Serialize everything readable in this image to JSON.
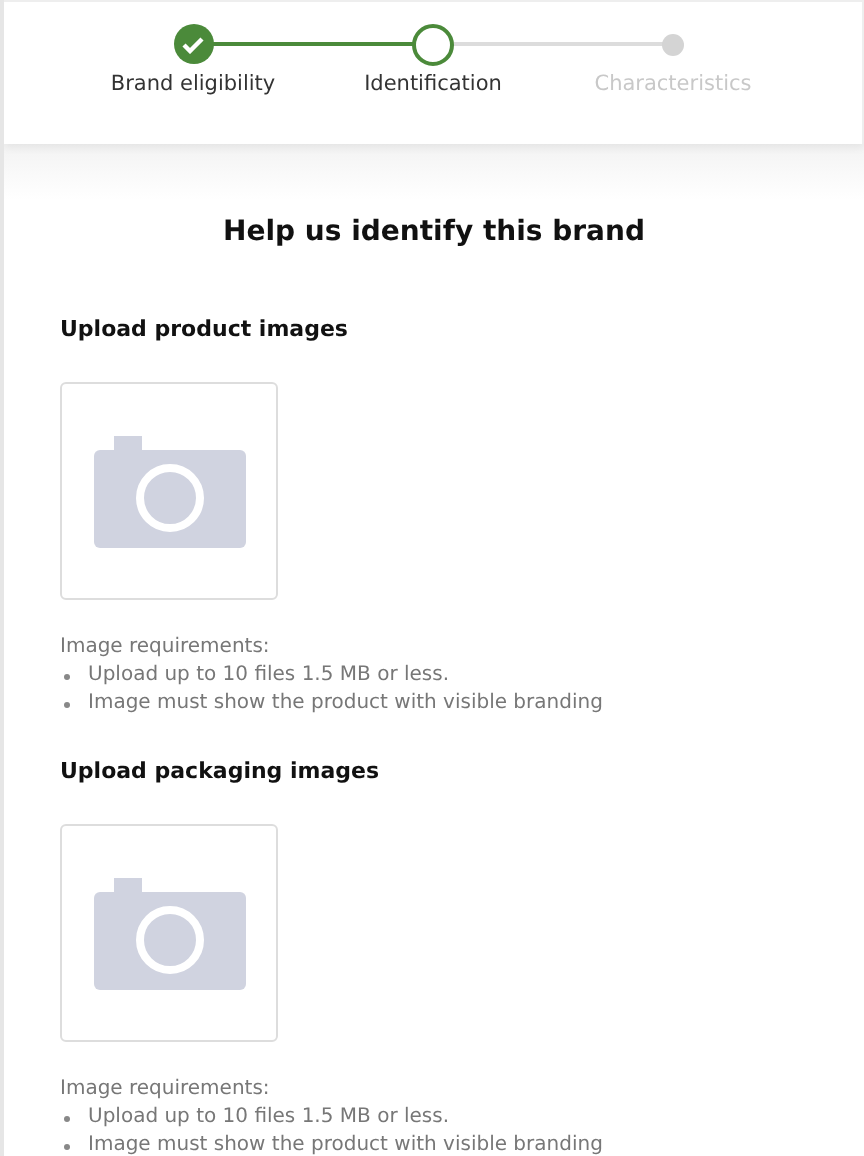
{
  "steps": [
    {
      "label": "Brand eligibility",
      "kind": "done"
    },
    {
      "label": "Identification",
      "kind": "current"
    },
    {
      "label": "Characteristics",
      "kind": "upcoming"
    }
  ],
  "title": "Help us identify this brand",
  "sections": [
    {
      "heading": "Upload product images",
      "requirements_title": "Image requirements:",
      "requirements": [
        "Upload up to 10 files 1.5 MB or less.",
        "Image must show the product with visible branding"
      ]
    },
    {
      "heading": "Upload packaging images",
      "requirements_title": "Image requirements:",
      "requirements": [
        "Upload up to 10 files 1.5 MB or less.",
        "Image must show the product with visible branding"
      ]
    }
  ]
}
